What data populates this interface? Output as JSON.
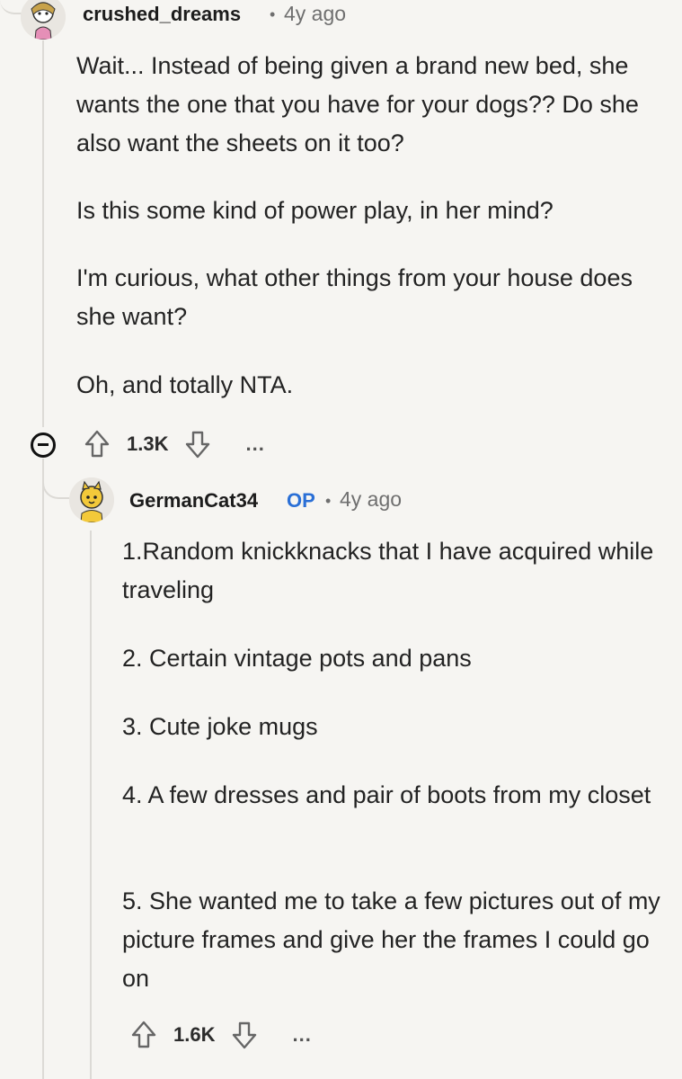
{
  "comments": [
    {
      "author": "crushed_dreams",
      "separator": "•",
      "time": "4y ago",
      "paragraphs": [
        "Wait... Instead of being given a brand new bed, she wants the one that you have for your dogs?? Do she also want the sheets on it too?",
        "Is this some kind of power play, in her mind?",
        "I'm curious, what other things from your house does she want?",
        "Oh, and totally NTA."
      ],
      "votes": "1.3K",
      "more": "..."
    },
    {
      "author": "GermanCat34",
      "op_label": "OP",
      "separator": "•",
      "time": "4y ago",
      "paragraphs": [
        "1.Random knickknacks that I have acquired while traveling",
        "2. Certain vintage pots and pans",
        "3. Cute joke mugs",
        "4. A few dresses and pair of boots from my closet",
        "5. She wanted me to take a few pictures out of my picture frames and give her the frames I could go on"
      ],
      "votes": "1.6K",
      "more": "..."
    }
  ]
}
